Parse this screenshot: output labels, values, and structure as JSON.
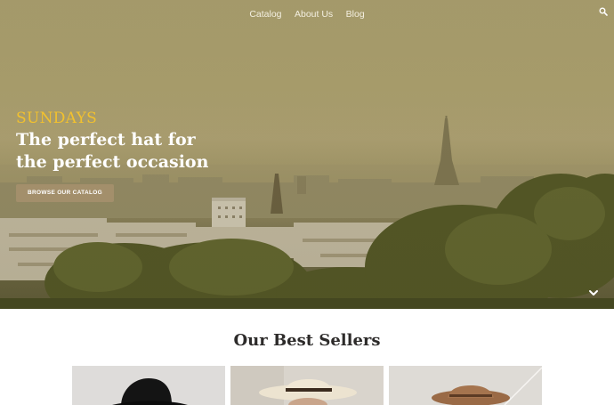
{
  "nav": {
    "items": [
      {
        "label": "Catalog"
      },
      {
        "label": "About Us"
      },
      {
        "label": "Blog"
      }
    ],
    "search_icon": "search-icon"
  },
  "hero": {
    "brand": "SUNDAYS",
    "headline_line1": "The perfect hat for",
    "headline_line2": "the perfect occasion",
    "cta_label": "BROWSE OUR CATALOG",
    "scroll_icon": "chevron-down-icon",
    "brand_color": "#f2c12e",
    "cta_color": "#a38f6b"
  },
  "best_sellers": {
    "title": "Our Best Sellers",
    "products": [
      {
        "image": "black-hat-photo"
      },
      {
        "image": "cream-hat-photo"
      },
      {
        "image": "brown-hat-photo"
      }
    ]
  }
}
